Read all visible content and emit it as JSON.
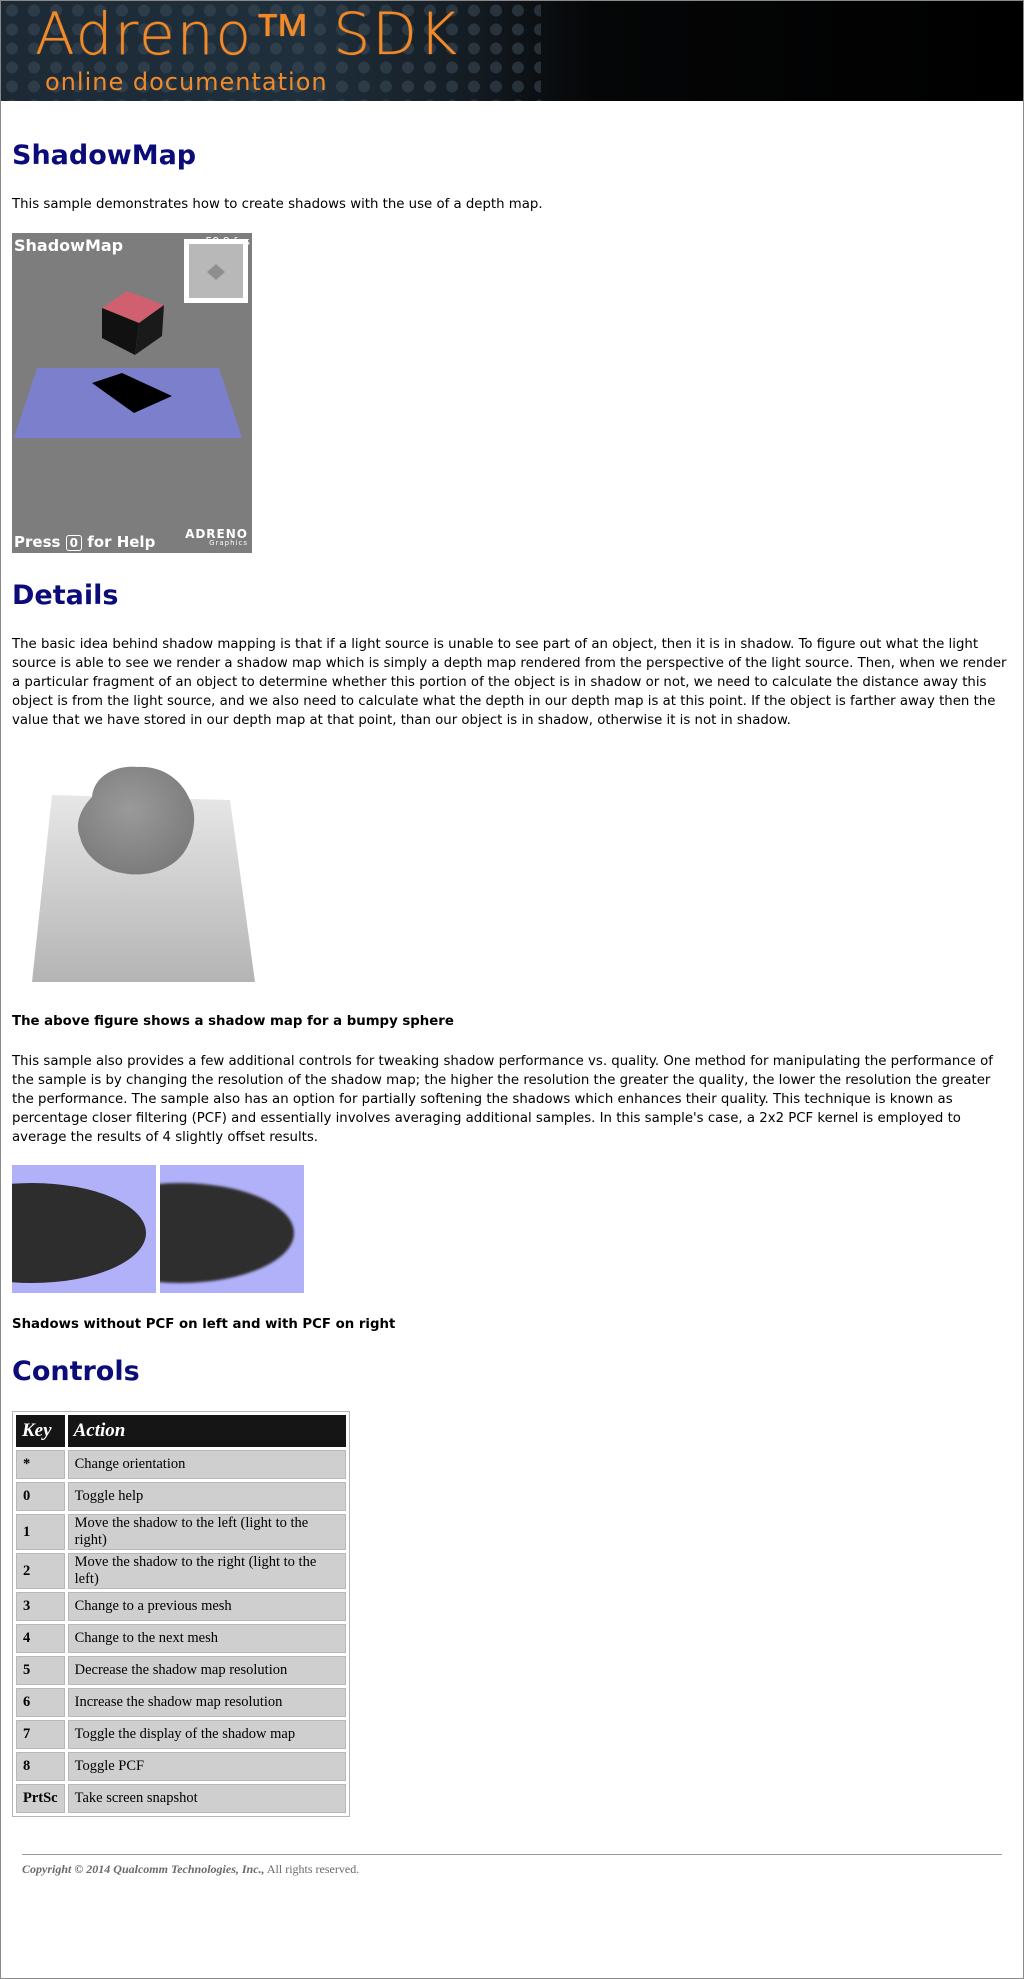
{
  "banner": {
    "title": "Adreno™ SDK",
    "subtitle": "online documentation"
  },
  "page": {
    "title": "ShadowMap",
    "intro": "This sample demonstrates how to create shadows with the use of a depth map."
  },
  "screenshot": {
    "app_label": "ShadowMap",
    "fps": "59.9 fps",
    "help_prefix": "Press",
    "help_key": "0",
    "help_suffix": "for Help",
    "logo": "ADRENO",
    "logo_sub": "Graphics"
  },
  "details": {
    "heading": "Details",
    "para1": "The basic idea behind shadow mapping is that if a light source is unable to see part of an object, then it is in shadow. To figure out what the light source is able to see we render a shadow map which is simply a depth map rendered from the perspective of the light source. Then, when we render a particular fragment of an object to determine whether this portion of the object is in shadow or not, we need to calculate the distance away this object is from the light source, and we also need to calculate what the depth in our depth map is at this point. If the object is farther away then the value that we have stored in our depth map at that point, than our object is in shadow, otherwise it is not in shadow.",
    "caption1": "The above figure shows a shadow map for a bumpy sphere",
    "para2": "This sample also provides a few additional controls for tweaking shadow performance vs. quality. One method for manipulating the performance of the sample is by changing the resolution of the shadow map; the higher the resolution the greater the quality, the lower the resolution the greater the performance. The sample also has an option for partially softening the shadows which enhances their quality. This technique is known as percentage closer filtering (PCF) and essentially involves averaging additional samples. In this sample's case, a 2x2 PCF kernel is employed to average the results of 4 slightly offset results.",
    "caption2": "Shadows without PCF on left and with PCF on right"
  },
  "controls": {
    "heading": "Controls",
    "headers": {
      "key": "Key",
      "action": "Action"
    },
    "rows": [
      {
        "key": "*",
        "action": "Change orientation"
      },
      {
        "key": "0",
        "action": "Toggle help"
      },
      {
        "key": "1",
        "action": "Move the shadow to the left (light to the right)"
      },
      {
        "key": "2",
        "action": "Move the shadow to the right (light to the left)"
      },
      {
        "key": "3",
        "action": "Change to a previous mesh"
      },
      {
        "key": "4",
        "action": "Change to the next mesh"
      },
      {
        "key": "5",
        "action": "Decrease the shadow map resolution"
      },
      {
        "key": "6",
        "action": "Increase the shadow map resolution"
      },
      {
        "key": "7",
        "action": "Toggle the display of the shadow map"
      },
      {
        "key": "8",
        "action": "Toggle PCF"
      },
      {
        "key": "PrtSc",
        "action": "Take screen snapshot"
      }
    ]
  },
  "footer": {
    "copyright": "Copyright © 2014 Qualcomm Technologies, Inc.,",
    "rights": "All rights reserved."
  },
  "colors": {
    "heading": "#0b0b7a",
    "banner_text": "#f08a2a",
    "shadow_plane": "#b1b1fa"
  }
}
